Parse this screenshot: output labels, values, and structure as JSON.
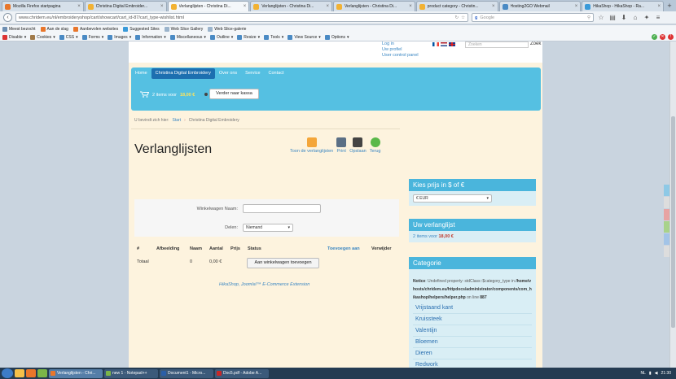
{
  "browser": {
    "tabs": [
      {
        "title": "Mozilla Firefox startpagina",
        "color": "#e8762b"
      },
      {
        "title": "Christina Digital Embroider...",
        "color": "#f2b233"
      },
      {
        "title": "Verlanglijsten - Christina Di...",
        "color": "#f2b233",
        "active": true
      },
      {
        "title": "Verlanglijsten - Christina Di...",
        "color": "#f2b233"
      },
      {
        "title": "Verlanglijsten - Christina Di...",
        "color": "#f2b233"
      },
      {
        "title": "product category - Christin...",
        "color": "#f2b233"
      },
      {
        "title": "Hosting2GO Webmail",
        "color": "#4a8ac4"
      },
      {
        "title": "HikaShop - HikaShop - Ra...",
        "color": "#3a9ad9"
      }
    ],
    "url": "www.chridem.eu/nl/embroideryshop/cart/showcart/cart_id-87/cart_type-wishlist.html",
    "search_placeholder": "Google",
    "search_engine": "g"
  },
  "bookmarks": [
    {
      "label": "Meest bezocht",
      "color": "#6d8fb3"
    },
    {
      "label": "Aan de slag",
      "color": "#e8762b"
    },
    {
      "label": "Aanbevolen websites",
      "color": "#e8762b"
    },
    {
      "label": "Suggested Sites",
      "color": "#3a9ad9"
    },
    {
      "label": "Web Slice Gallery",
      "color": "#9bb4cc"
    },
    {
      "label": "Web Slice-galerie",
      "color": "#9bb4cc"
    }
  ],
  "devtools": [
    {
      "label": "Disable",
      "color": "#d33"
    },
    {
      "label": "Cookies",
      "color": "#a07a4a"
    },
    {
      "label": "CSS",
      "color": "#4a8ac4"
    },
    {
      "label": "Forms",
      "color": "#4a8ac4"
    },
    {
      "label": "Images",
      "color": "#4a8ac4"
    },
    {
      "label": "Information",
      "color": "#4a8ac4"
    },
    {
      "label": "Miscellaneous",
      "color": "#4a8ac4"
    },
    {
      "label": "Outline",
      "color": "#4a8ac4"
    },
    {
      "label": "Resize",
      "color": "#4a8ac4"
    },
    {
      "label": "Tools",
      "color": "#4a8ac4"
    },
    {
      "label": "View Source",
      "color": "#4a8ac4"
    },
    {
      "label": "Options",
      "color": "#4a8ac4"
    }
  ],
  "site": {
    "top_links": [
      "Log in",
      "Uw profiel",
      "User control panel"
    ],
    "search_placeholder": "Zoeken",
    "search_button": "Zoek",
    "menu": [
      "Home",
      "Christina Digital Embroidery",
      "Over ons",
      "Service",
      "Contact"
    ],
    "menu_active_index": 1,
    "cart": {
      "text": "2 items voor",
      "price": "18,00 €",
      "button": "Verder naar kassa"
    },
    "breadcrumb": {
      "prefix": "U bevindt zich hier:",
      "start": "Start",
      "current": "Christina Digital Embroidery"
    },
    "title": "Verlanglijsten",
    "actions": [
      {
        "label": "Toon de verlanglijsten",
        "color": "#f4a63a"
      },
      {
        "label": "Print",
        "color": "#5b6f85"
      },
      {
        "label": "Opslaan",
        "color": "#444"
      },
      {
        "label": "Terug",
        "color": "#5ab84a"
      }
    ],
    "form": {
      "name_label": "Winkelwagen Naam:",
      "share_label": "Delen:",
      "share_value": "Niemand"
    },
    "table": {
      "headers": [
        "#",
        "Afbeelding",
        "Naam",
        "Aantal",
        "Prijs",
        "Status",
        "Toevoegen aan",
        "Verwijder"
      ],
      "total_label": "Totaal",
      "total_qty": "0",
      "total_price": "0,00 €",
      "add_button": "Aan winkelwagen toevoegen"
    },
    "footer_link": "HikaShop, Joomla!™ E-Commerce Extension",
    "sidebar": {
      "currency_title": "Kies prijs in $ of €",
      "currency_value": "€ EUR",
      "wishlist_title": "Uw verlanglijst",
      "wishlist_text": "2 items voor",
      "wishlist_price": "18,00 €",
      "category_title": "Categorie",
      "notice_label": "Notice",
      "notice_text": ": Undefined property: stdClass::$category_type in",
      "notice_path": "/home/vhosts/chridem.eu/httpdocs/administrator/components/com_hikashop/helpers/helper.php",
      "notice_line_prefix": "on line",
      "notice_line": "887",
      "categories": [
        "Vrijstaand kant",
        "Kruissteek",
        "Valentijn",
        "Bloemen",
        "Dieren",
        "Redwork"
      ]
    }
  },
  "taskbar": {
    "tasks": [
      {
        "label": "Verlanglijsten - Chri...",
        "color": "#e8762b",
        "active": true
      },
      {
        "label": "new 1 - Notepad++",
        "color": "#7bb548"
      },
      {
        "label": "Document1 - Micro...",
        "color": "#2b5fa8"
      },
      {
        "label": "Doc5.pdf - Adobe A...",
        "color": "#c62828"
      }
    ],
    "lang": "NL",
    "time": "21:30"
  }
}
